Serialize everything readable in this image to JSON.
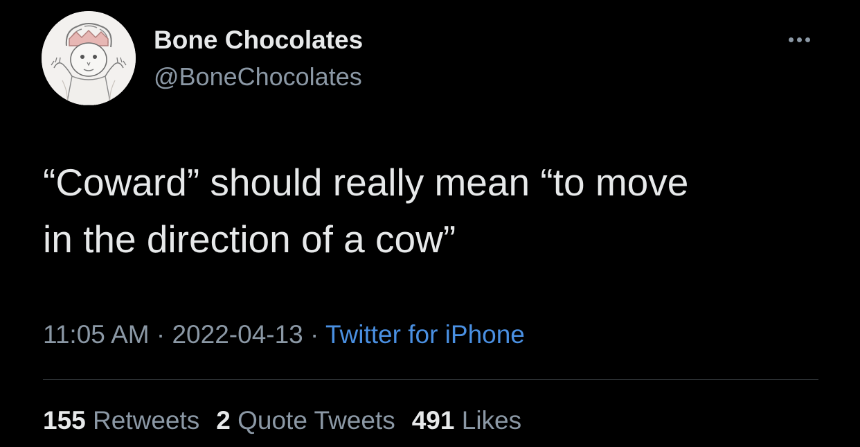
{
  "author": {
    "display_name": "Bone Chocolates",
    "handle": "@BoneChocolates"
  },
  "tweet": {
    "text": "“Coward” should really mean “to move\nin the direction of a cow”",
    "time": "11:05 AM",
    "separator": " · ",
    "date": "2022-04-13",
    "source": "Twitter for iPhone"
  },
  "stats": {
    "retweets_count": "155",
    "retweets_label": "Retweets",
    "quotes_count": "2",
    "quotes_label": "Quote Tweets",
    "likes_count": "491",
    "likes_label": "Likes"
  },
  "icons": {
    "more": "more-horizontal-icon",
    "avatar": "avatar-image"
  },
  "colors": {
    "background": "#000000",
    "primary_text": "#e7e9ea",
    "secondary_text": "#8b98a5",
    "link": "#4a90e2",
    "divider": "#2f3336"
  }
}
